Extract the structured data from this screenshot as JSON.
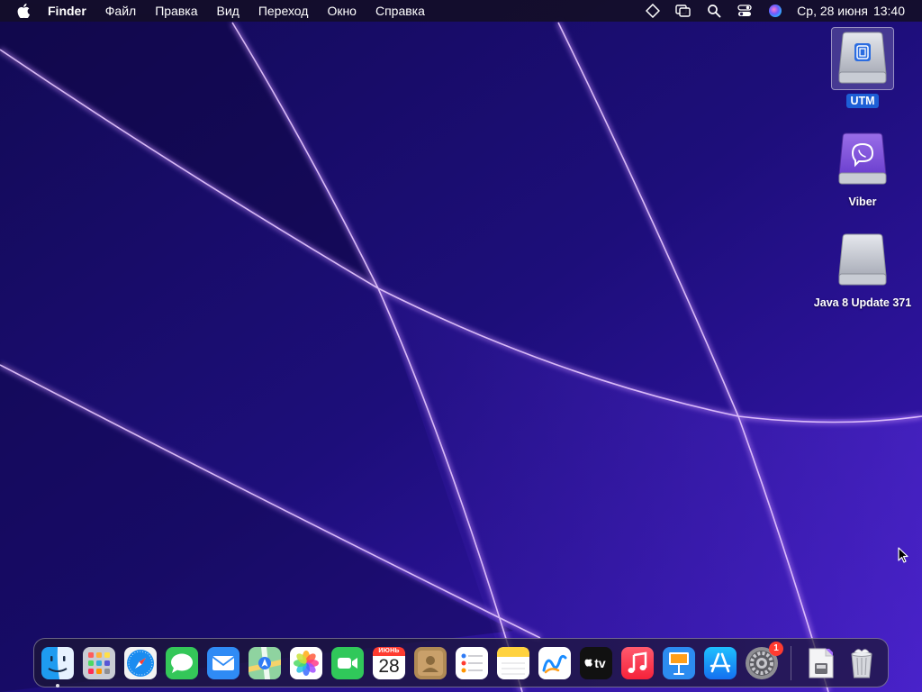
{
  "menubar": {
    "apple_icon": "apple-logo-icon",
    "items": [
      "Finder",
      "Файл",
      "Правка",
      "Вид",
      "Переход",
      "Окно",
      "Справка"
    ],
    "status_icons": [
      "diamond-icon",
      "display-mirror-icon",
      "search-icon",
      "control-center-icon",
      "siri-icon"
    ],
    "date": "Ср, 28 июня",
    "time": "13:40"
  },
  "desktop": {
    "icons": [
      {
        "label": "UTM",
        "icon": "utm-disk-icon",
        "selected": true
      },
      {
        "label": "Viber",
        "icon": "viber-disk-icon",
        "selected": false
      },
      {
        "label": "Java 8 Update 371",
        "icon": "java-disk-icon",
        "selected": false
      }
    ]
  },
  "dock": {
    "apps": [
      {
        "name": "Finder",
        "icon": "finder-icon",
        "running": true
      },
      {
        "name": "Launchpad",
        "icon": "launchpad-icon"
      },
      {
        "name": "Safari",
        "icon": "safari-icon"
      },
      {
        "name": "Messages",
        "icon": "messages-icon"
      },
      {
        "name": "Mail",
        "icon": "mail-icon"
      },
      {
        "name": "Maps",
        "icon": "maps-icon"
      },
      {
        "name": "Photos",
        "icon": "photos-icon"
      },
      {
        "name": "FaceTime",
        "icon": "facetime-icon"
      },
      {
        "name": "Calendar",
        "icon": "calendar-icon",
        "month": "ИЮНЬ",
        "day": "28"
      },
      {
        "name": "Contacts",
        "icon": "contacts-icon"
      },
      {
        "name": "Reminders",
        "icon": "reminders-icon"
      },
      {
        "name": "Notes",
        "icon": "notes-icon"
      },
      {
        "name": "Freeform",
        "icon": "freeform-icon"
      },
      {
        "name": "TV",
        "icon": "apple-tv-icon",
        "label": "tv"
      },
      {
        "name": "Music",
        "icon": "music-icon"
      },
      {
        "name": "Keynote",
        "icon": "keynote-icon"
      },
      {
        "name": "App Store",
        "icon": "app-store-icon"
      },
      {
        "name": "System Settings",
        "icon": "system-settings-icon",
        "badge": "1"
      }
    ],
    "extras": [
      {
        "name": "Downloads",
        "icon": "downloads-stack-icon"
      },
      {
        "name": "Trash",
        "icon": "trash-icon"
      }
    ]
  },
  "colors": {
    "wallpaper_base": "#1a0c6e",
    "wallpaper_glow": "#c890ff",
    "selection": "#1d5fd6",
    "badge": "#ff3b30"
  }
}
